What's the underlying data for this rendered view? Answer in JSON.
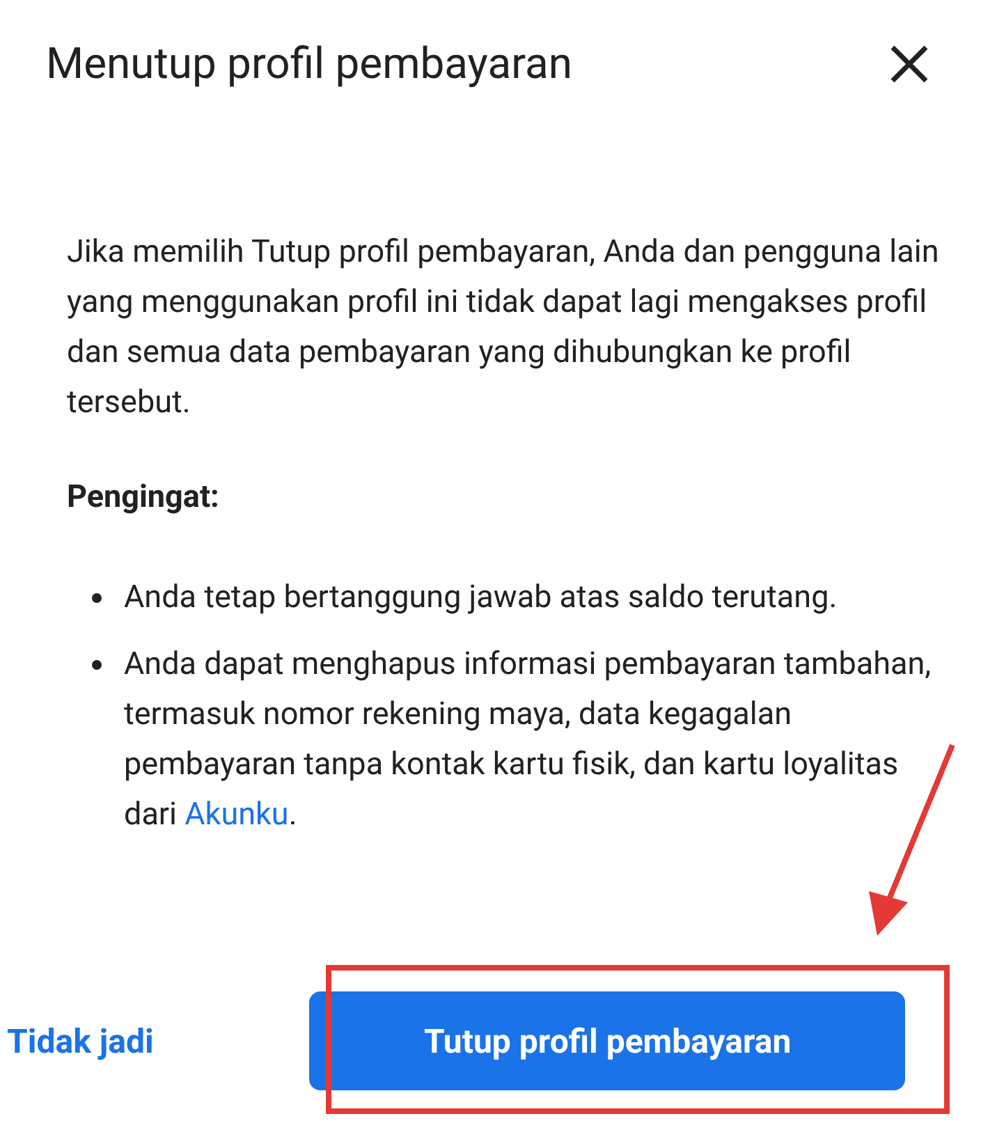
{
  "dialog": {
    "title": "Menutup profil pembayaran"
  },
  "body": {
    "paragraph": "Jika memilih Tutup profil pembayaran, Anda dan pengguna lain yang menggunakan profil ini tidak dapat lagi mengakses profil dan semua data pembayaran yang dihubungkan ke profil tersebut.",
    "heading": "Pengingat:",
    "bullets": [
      {
        "text": "Anda tetap bertanggung jawab atas saldo terutang."
      },
      {
        "text": "Anda dapat menghapus informasi pembayaran tambahan, termasuk nomor rekening maya, data kegagalan pembayaran tanpa kontak kartu fisik, dan kartu loyalitas dari ",
        "link": "Akunku",
        "after": "."
      }
    ]
  },
  "buttons": {
    "cancel": "Tidak jadi",
    "confirm": "Tutup profil pembayaran"
  }
}
